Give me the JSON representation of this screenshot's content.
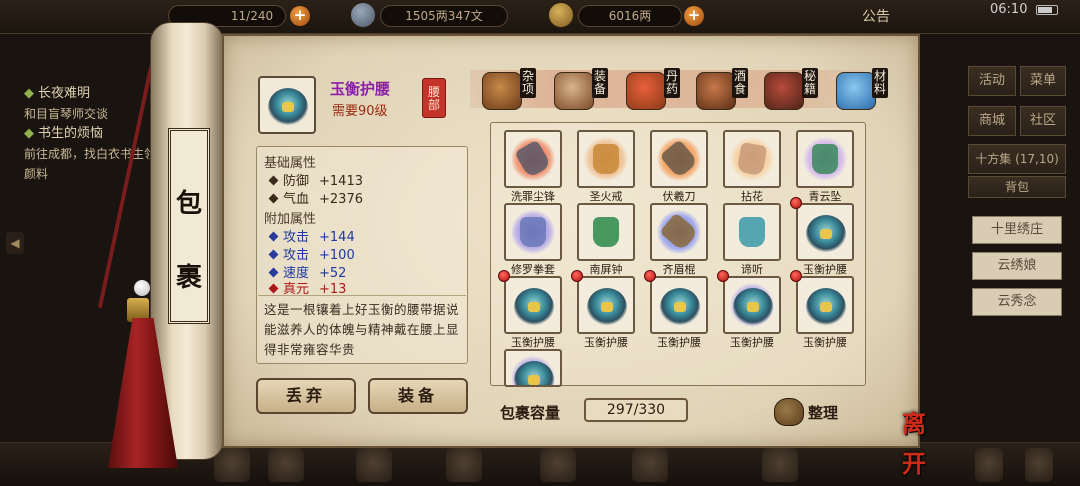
{
  "topbar": {
    "bag_count": "11/240",
    "copper": "1505两347文",
    "silver": "6016两",
    "notice": "公告",
    "time": "06:10"
  },
  "quest": {
    "items": [
      {
        "title": "长夜难明",
        "text": "和目盲琴师交谈"
      },
      {
        "title": "书生的烦恼",
        "text": "前往成都，找白衣书生领取颜料"
      }
    ]
  },
  "right_menu": {
    "buttons": [
      "活动",
      "菜单",
      "商城",
      "社区"
    ],
    "location": "十方集",
    "coords": "(17,10)",
    "bag_tab": "背包",
    "npcs": [
      "十里绣庄",
      "云绣娘",
      "云秀念"
    ]
  },
  "scroll_title": [
    "包",
    "裹"
  ],
  "selected_item": {
    "name": "玉衡护腰",
    "requirement": "需要90级",
    "slot": "腰部"
  },
  "attributes": {
    "base_header": "基础属性",
    "base": [
      {
        "label": "防御",
        "value": "+1413"
      },
      {
        "label": "气血",
        "value": "+2376"
      }
    ],
    "extra_header": "附加属性",
    "extra": [
      {
        "label": "攻击",
        "value": "+144",
        "color": "blue"
      },
      {
        "label": "攻击",
        "value": "+100",
        "color": "blue"
      },
      {
        "label": "速度",
        "value": "+52",
        "color": "blue"
      },
      {
        "label": "真元",
        "value": "+13",
        "color": "red"
      }
    ],
    "description": "这是一根镶着上好玉衡的腰带据说能滋养人的体魄与精神戴在腰上显得非常雍容华贵"
  },
  "actions": {
    "discard": "丢弃",
    "equip": "装备"
  },
  "tabs": [
    {
      "label": "杂项",
      "icon": "jar-icon"
    },
    {
      "label": "装备",
      "icon": "scroll-weapon-icon"
    },
    {
      "label": "丹药",
      "icon": "pills-icon"
    },
    {
      "label": "酒食",
      "icon": "wine-food-icon"
    },
    {
      "label": "秘籍",
      "icon": "books-icon"
    },
    {
      "label": "材料",
      "icon": "crystal-icon"
    }
  ],
  "inventory": [
    {
      "name": "洗罪尘锋",
      "icon": "sword-icon",
      "c1": "#e8503a",
      "c2": "#f0a080",
      "new": false
    },
    {
      "name": "圣火戒",
      "icon": "ring-icon",
      "c1": "#e0a060",
      "c2": "#f0c8a0",
      "new": false
    },
    {
      "name": "伏羲刀",
      "icon": "blade-icon",
      "c1": "#e87a2a",
      "c2": "#f4b078",
      "new": false
    },
    {
      "name": "拈花",
      "icon": "flower-icon",
      "c1": "#f0b060",
      "c2": "#f6d8b0",
      "new": false
    },
    {
      "name": "青云坠",
      "icon": "pendant-icon",
      "c1": "#b080d8",
      "c2": "#d8c0ec",
      "new": false
    },
    {
      "name": "修罗拳套",
      "icon": "gauntlet-icon",
      "c1": "#7a6ac8",
      "c2": "#c0b4e8",
      "new": false
    },
    {
      "name": "南屏钟",
      "icon": "bell-icon",
      "c1": "#e8e0c8",
      "c2": "#f2ecdc",
      "new": false
    },
    {
      "name": "齐眉棍",
      "icon": "staff-icon",
      "c1": "#5a6ad0",
      "c2": "#a8b0ec",
      "new": false
    },
    {
      "name": "谛听",
      "icon": "beast-charm-icon",
      "c1": "#e8e0c8",
      "c2": "#f2ecdc",
      "new": false
    },
    {
      "name": "玉衡护腰",
      "icon": "belt-icon",
      "c1": "#e8e0c8",
      "c2": "#f2ecdc",
      "new": true
    },
    {
      "name": "玉衡护腰",
      "icon": "belt-icon",
      "c1": "#e8e0c8",
      "c2": "#f2ecdc",
      "new": true
    },
    {
      "name": "玉衡护腰",
      "icon": "belt-icon",
      "c1": "#e8e0c8",
      "c2": "#f2ecdc",
      "new": true
    },
    {
      "name": "玉衡护腰",
      "icon": "belt-icon",
      "c1": "#e8e0c8",
      "c2": "#f2ecdc",
      "new": true
    },
    {
      "name": "玉衡护腰",
      "icon": "belt-icon",
      "c1": "#7a6ac8",
      "c2": "#c0b4e8",
      "new": true
    },
    {
      "name": "玉衡护腰",
      "icon": "belt-icon",
      "c1": "#e8e0c8",
      "c2": "#f2ecdc",
      "new": true
    },
    {
      "name": "",
      "icon": "belt-icon",
      "c1": "#7a6ac8",
      "c2": "#c0b4e8",
      "new": false
    }
  ],
  "capacity": {
    "label": "包裹容量",
    "value": "297/330"
  },
  "sort_label": "整理",
  "leave_label": "离开"
}
